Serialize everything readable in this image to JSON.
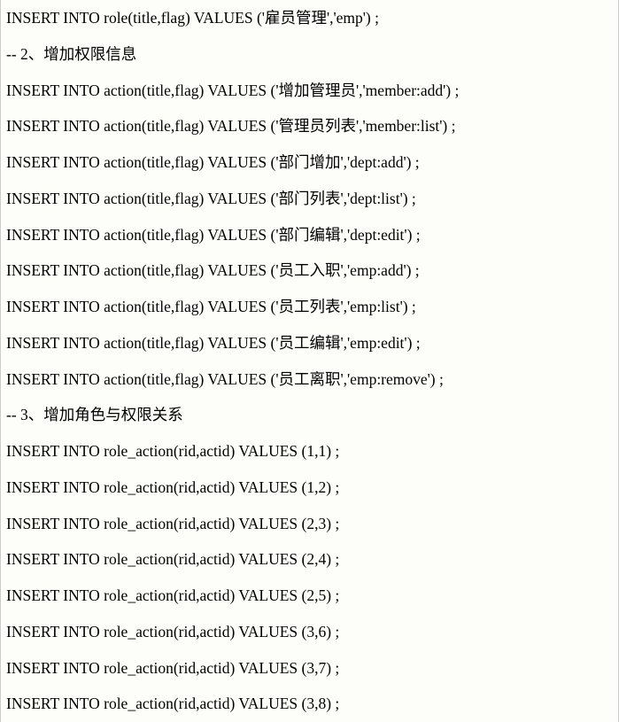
{
  "lines": [
    "INSERT INTO role(title,flag) VALUES ('雇员管理','emp') ;",
    "-- 2、增加权限信息",
    "INSERT INTO action(title,flag) VALUES ('增加管理员','member:add') ;",
    "INSERT INTO action(title,flag) VALUES ('管理员列表','member:list') ;",
    "INSERT INTO action(title,flag) VALUES ('部门增加','dept:add') ;",
    "INSERT INTO action(title,flag) VALUES ('部门列表','dept:list') ;",
    "INSERT INTO action(title,flag) VALUES ('部门编辑','dept:edit') ;",
    "INSERT INTO action(title,flag) VALUES ('员工入职','emp:add') ;",
    "INSERT INTO action(title,flag) VALUES ('员工列表','emp:list') ;",
    "INSERT INTO action(title,flag) VALUES ('员工编辑','emp:edit') ;",
    "INSERT INTO action(title,flag) VALUES ('员工离职','emp:remove') ;",
    "-- 3、增加角色与权限关系",
    "INSERT INTO role_action(rid,actid) VALUES (1,1) ;",
    "INSERT INTO role_action(rid,actid) VALUES (1,2) ;",
    "INSERT INTO role_action(rid,actid) VALUES (2,3) ;",
    "INSERT INTO role_action(rid,actid) VALUES (2,4) ;",
    "INSERT INTO role_action(rid,actid) VALUES (2,5) ;",
    "INSERT INTO role_action(rid,actid) VALUES (3,6) ;",
    "INSERT INTO role_action(rid,actid) VALUES (3,7) ;",
    "INSERT INTO role_action(rid,actid) VALUES (3,8) ;"
  ]
}
